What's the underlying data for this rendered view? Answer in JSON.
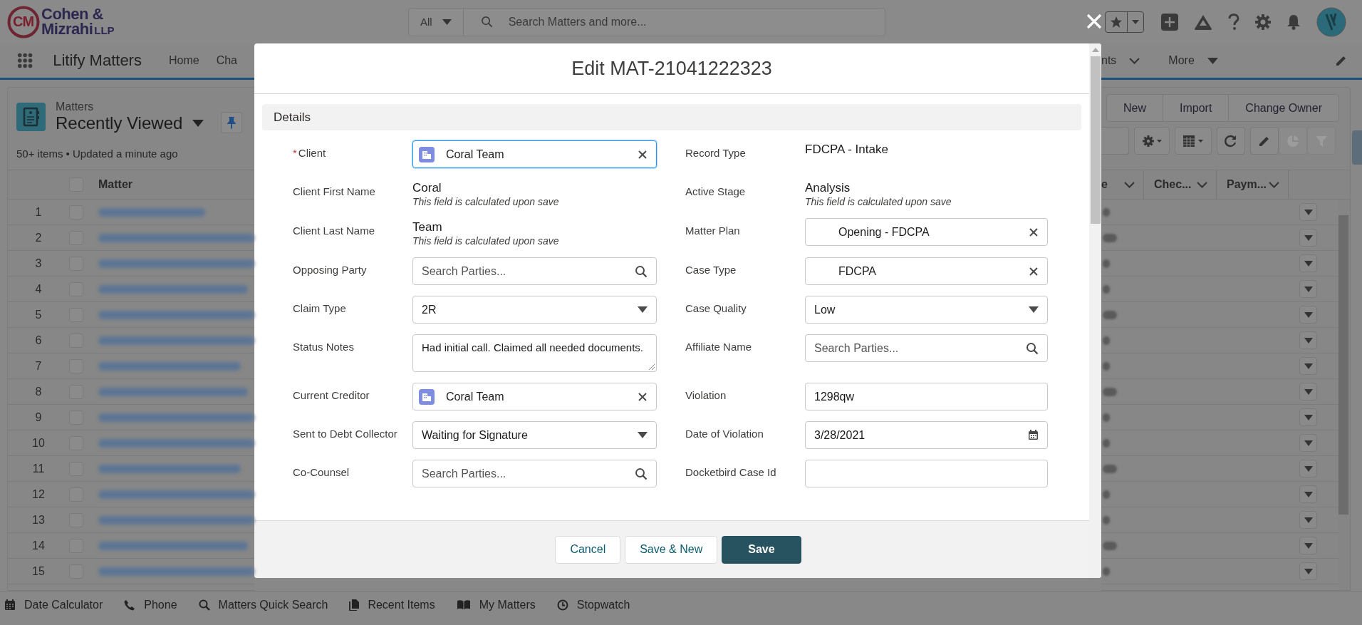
{
  "header": {
    "logo": {
      "monogram": "CM",
      "line1": "Cohen &",
      "line2": "Mizrahi",
      "suffix": "LLP"
    },
    "search": {
      "scope": "All",
      "placeholder": "Search Matters and more..."
    }
  },
  "nav": {
    "app_name": "Litify Matters",
    "items": [
      {
        "label": "Home"
      },
      {
        "label": "Cha"
      }
    ],
    "right_items": [
      {
        "label": "nts",
        "kind": "chevron"
      },
      {
        "label": "More",
        "kind": "caret"
      }
    ]
  },
  "list_view": {
    "select_all_checked": false,
    "object": "Matters",
    "title": "Recently Viewed",
    "status": "50+ items • Updated a minute ago",
    "actions": [
      "New",
      "Import",
      "Change Owner"
    ],
    "toolbar_buttons": [
      {
        "disabled": false
      },
      {
        "disabled": false
      },
      {
        "disabled": false
      },
      {
        "disabled": false
      },
      {
        "disabled": true
      },
      {
        "disabled": true
      }
    ],
    "columns": [
      {
        "label": "Matter"
      },
      {
        "label": "e"
      },
      {
        "label": "Chec..."
      },
      {
        "label": "Paym..."
      }
    ],
    "rows": [
      {
        "number": "1",
        "checked": false
      },
      {
        "number": "2",
        "checked": false
      },
      {
        "number": "3",
        "checked": false
      },
      {
        "number": "4",
        "checked": false
      },
      {
        "number": "5",
        "checked": false
      },
      {
        "number": "6",
        "checked": false
      },
      {
        "number": "7",
        "checked": false
      },
      {
        "number": "8",
        "checked": false
      },
      {
        "number": "9",
        "checked": false
      },
      {
        "number": "10",
        "checked": false
      },
      {
        "number": "11",
        "checked": false
      },
      {
        "number": "12",
        "checked": false
      },
      {
        "number": "13",
        "checked": false
      },
      {
        "number": "14",
        "checked": false
      },
      {
        "number": "15",
        "checked": false
      }
    ]
  },
  "modal": {
    "title": "Edit MAT-21041222323",
    "section": "Details",
    "required_mark": "*",
    "rows": [
      {
        "left": {
          "label": "Client",
          "kind": "lookup",
          "value": "Coral Team",
          "icon": true,
          "required": true,
          "focused": true
        },
        "right": {
          "label": "Record Type",
          "kind": "static",
          "value": "FDCPA - Intake",
          "required": false
        }
      },
      {
        "left": {
          "label": "Client First Name",
          "kind": "static",
          "value": "Coral",
          "note": "This field is calculated upon save",
          "required": false
        },
        "right": {
          "label": "Active Stage",
          "kind": "static",
          "value": "Analysis",
          "note": "This field is calculated upon save",
          "required": false
        }
      },
      {
        "left": {
          "label": "Client Last Name",
          "kind": "static",
          "value": "Team",
          "note": "This field is calculated upon save",
          "required": false
        },
        "right": {
          "label": "Matter Plan",
          "kind": "lookup",
          "value": "Opening - FDCPA",
          "icon": false,
          "required": false,
          "focused": false
        }
      },
      {
        "left": {
          "label": "Opposing Party",
          "kind": "search",
          "placeholder": "Search Parties...",
          "required": false,
          "focused": false
        },
        "right": {
          "label": "Case Type",
          "kind": "lookup",
          "value": "FDCPA",
          "icon": false,
          "required": false,
          "focused": false
        }
      },
      {
        "left": {
          "label": "Claim Type",
          "kind": "picklist",
          "value": "2R",
          "required": false,
          "focused": false
        },
        "right": {
          "label": "Case Quality",
          "kind": "picklist",
          "value": "Low",
          "required": false,
          "focused": false
        }
      },
      {
        "left": {
          "label": "Status Notes",
          "kind": "textarea",
          "value": "Had initial call. Claimed all needed documents.",
          "required": false,
          "focused": false
        },
        "right": {
          "label": "Affiliate Name",
          "kind": "search",
          "placeholder": "Search Parties...",
          "required": false,
          "focused": false
        }
      },
      {
        "left": {
          "label": "Current Creditor",
          "kind": "lookup",
          "value": "Coral Team",
          "icon": true,
          "required": false,
          "focused": false
        },
        "right": {
          "label": "Violation",
          "kind": "input",
          "value": "1298qw",
          "required": false,
          "focused": false
        }
      },
      {
        "left": {
          "label": "Sent to Debt Collector",
          "kind": "picklist",
          "value": "Waiting for Signature",
          "required": false,
          "focused": false
        },
        "right": {
          "label": "Date of Violation",
          "kind": "date",
          "value": "3/28/2021",
          "required": false,
          "focused": false
        }
      },
      {
        "left": {
          "label": "Co-Counsel",
          "kind": "search",
          "placeholder": "Search Parties...",
          "required": false,
          "focused": false
        },
        "right": {
          "label": "Docketbird Case Id",
          "kind": "input",
          "required": false,
          "focused": false
        }
      }
    ],
    "buttons": [
      {
        "label": "Cancel",
        "kind": "neutral"
      },
      {
        "label": "Save & New",
        "kind": "neutral"
      },
      {
        "label": "Save",
        "kind": "brand"
      }
    ]
  },
  "utility_bar": [
    {
      "label": "Date Calculator"
    },
    {
      "label": "Phone"
    },
    {
      "label": "Matters Quick Search"
    },
    {
      "label": "Recent Items"
    },
    {
      "label": "My Matters"
    },
    {
      "label": "Stopwatch"
    }
  ]
}
